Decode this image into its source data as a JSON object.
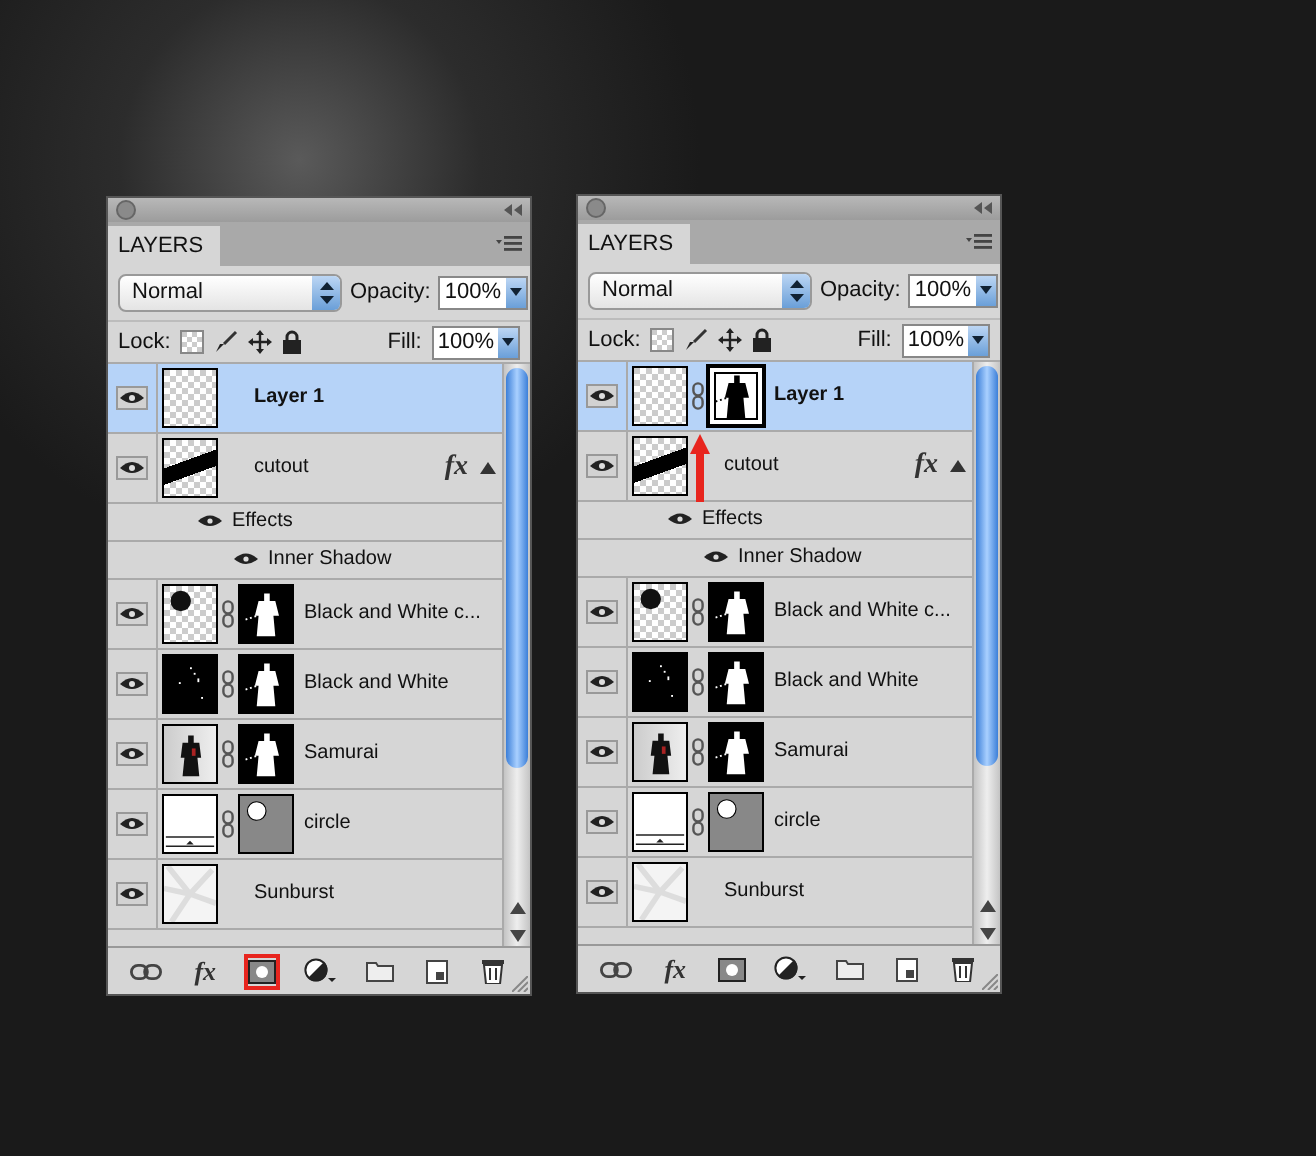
{
  "panels": [
    {
      "tab": "LAYERS",
      "blend_mode": "Normal",
      "opacity_label": "Opacity:",
      "opacity": "100%",
      "lock_label": "Lock:",
      "fill_label": "Fill:",
      "fill": "100%",
      "arrow_annotation": false,
      "layers": [
        {
          "name": "Layer 1",
          "selected": true,
          "visible": true,
          "thumbnail": {
            "kind": "transparent"
          }
        },
        {
          "name": "cutout",
          "selected": false,
          "visible": true,
          "thumbnail": {
            "kind": "stripe"
          },
          "fx": "fx",
          "effects_expanded": true,
          "effects": [
            {
              "label": "Effects",
              "visible": true,
              "children": [
                {
                  "label": "Inner Shadow",
                  "visible": true
                }
              ]
            }
          ]
        },
        {
          "name": "Black and White c...",
          "selected": false,
          "visible": true,
          "thumbnail": {
            "kind": "moon"
          },
          "mask": {
            "kind": "silhouette",
            "selected": false
          }
        },
        {
          "name": "Black and White",
          "selected": false,
          "visible": true,
          "thumbnail": {
            "kind": "dark"
          },
          "mask": {
            "kind": "silhouette",
            "selected": false
          }
        },
        {
          "name": "Samurai",
          "selected": false,
          "visible": true,
          "thumbnail": {
            "kind": "photo"
          },
          "mask": {
            "kind": "silhouette",
            "selected": false
          }
        },
        {
          "name": "circle",
          "selected": false,
          "visible": true,
          "thumbnail": {
            "kind": "fill"
          },
          "mask": {
            "kind": "circle",
            "selected": false
          }
        },
        {
          "name": "Sunburst",
          "selected": false,
          "visible": true,
          "thumbnail": {
            "kind": "sunburst"
          }
        }
      ],
      "toolbar": [
        {
          "kind": "link",
          "highlighted": false
        },
        {
          "kind": "fx",
          "label": "fx",
          "highlighted": false
        },
        {
          "kind": "mask",
          "highlighted": true
        },
        {
          "kind": "adjustment",
          "highlighted": false
        },
        {
          "kind": "folder",
          "highlighted": false
        },
        {
          "kind": "new",
          "highlighted": false
        },
        {
          "kind": "trash",
          "highlighted": false
        }
      ]
    },
    {
      "tab": "LAYERS",
      "blend_mode": "Normal",
      "opacity_label": "Opacity:",
      "opacity": "100%",
      "lock_label": "Lock:",
      "fill_label": "Fill:",
      "fill": "100%",
      "arrow_annotation": true,
      "layers": [
        {
          "name": "Layer 1",
          "selected": true,
          "visible": true,
          "thumbnail": {
            "kind": "transparent"
          },
          "mask": {
            "kind": "inverse",
            "selected": true
          }
        },
        {
          "name": "cutout",
          "selected": false,
          "visible": true,
          "thumbnail": {
            "kind": "stripe"
          },
          "fx": "fx",
          "effects_expanded": true,
          "effects": [
            {
              "label": "Effects",
              "visible": true,
              "children": [
                {
                  "label": "Inner Shadow",
                  "visible": true
                }
              ]
            }
          ]
        },
        {
          "name": "Black and White c...",
          "selected": false,
          "visible": true,
          "thumbnail": {
            "kind": "moon"
          },
          "mask": {
            "kind": "silhouette",
            "selected": false
          }
        },
        {
          "name": "Black and White",
          "selected": false,
          "visible": true,
          "thumbnail": {
            "kind": "dark"
          },
          "mask": {
            "kind": "silhouette",
            "selected": false
          }
        },
        {
          "name": "Samurai",
          "selected": false,
          "visible": true,
          "thumbnail": {
            "kind": "photo"
          },
          "mask": {
            "kind": "silhouette",
            "selected": false
          }
        },
        {
          "name": "circle",
          "selected": false,
          "visible": true,
          "thumbnail": {
            "kind": "fill"
          },
          "mask": {
            "kind": "circle",
            "selected": false
          }
        },
        {
          "name": "Sunburst",
          "selected": false,
          "visible": true,
          "thumbnail": {
            "kind": "sunburst"
          }
        }
      ],
      "toolbar": [
        {
          "kind": "link",
          "highlighted": false
        },
        {
          "kind": "fx",
          "label": "fx",
          "highlighted": false
        },
        {
          "kind": "mask",
          "highlighted": false
        },
        {
          "kind": "adjustment",
          "highlighted": false
        },
        {
          "kind": "folder",
          "highlighted": false
        },
        {
          "kind": "new",
          "highlighted": false
        },
        {
          "kind": "trash",
          "highlighted": false
        }
      ]
    }
  ]
}
